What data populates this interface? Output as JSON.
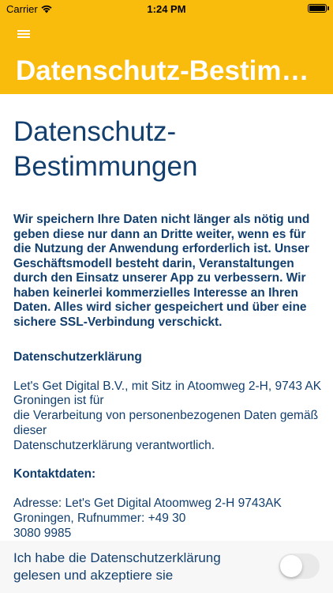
{
  "status_bar": {
    "carrier": "Carrier",
    "time": "1:24 PM"
  },
  "header": {
    "menu_icon": "hamburger-menu-icon",
    "title": "Datenschutz-Bestimmungen",
    "background_color": "#f9bb0c"
  },
  "content": {
    "title": "Datenschutz-Bestimmungen",
    "intro": "Wir speichern Ihre Daten nicht länger als nötig und geben diese nur dann an Dritte weiter, wenn es für die Nutzung der Anwendung erforderlich ist. Unser Geschäftsmodell besteht darin, Veranstaltungen durch den Einsatz unserer App zu verbessern. Wir haben keinerlei kommerzielles Interesse an Ihren Daten. Alles wird sicher gespeichert und über eine sichere SSL-Verbindung verschickt.",
    "section_privacy": {
      "heading": "Datenschutzerklärung",
      "body": "Let's Get Digital B.V., mit Sitz in Atoomweg 2-H, 9743 AK Groningen ist für\ndie Verarbeitung von personenbezogenen Daten gemäß dieser\nDatenschutzerklärung verantwortlich."
    },
    "section_contact": {
      "heading": "Kontaktdaten:",
      "body": "Adresse: Let's Get Digital Atoomweg 2-H 9743AK Groningen, Rufnummer: +49 30\n3080 9985"
    },
    "text_color": "#123f6e"
  },
  "consent": {
    "label": "Ich habe die Datenschutzerklärung gelesen und akzeptiere sie",
    "toggle_on": false
  }
}
